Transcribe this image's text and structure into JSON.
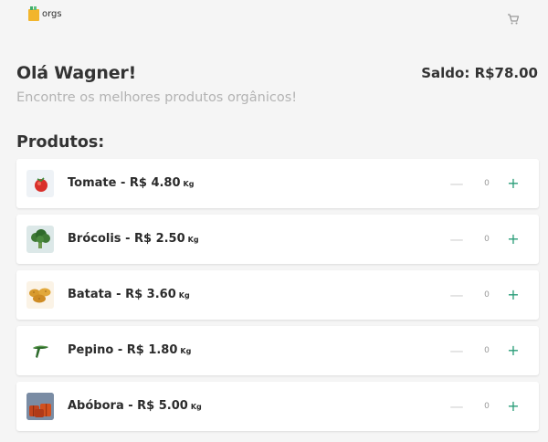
{
  "app": {
    "logo_text": "orgs"
  },
  "header": {
    "greeting": "Olá Wagner!",
    "balance": "Saldo: R$78.00",
    "subtitle": "Encontre os melhores produtos orgânicos!"
  },
  "products_title": "Produtos:",
  "products": [
    {
      "label": "Tomate - R$ 4.80",
      "unit": "Kg",
      "quantity": "0",
      "minus": "—",
      "plus": "+",
      "icon": "tomato-icon"
    },
    {
      "label": "Brócolis - R$ 2.50",
      "unit": "Kg",
      "quantity": "0",
      "minus": "—",
      "plus": "+",
      "icon": "broccoli-icon"
    },
    {
      "label": "Batata - R$ 3.60",
      "unit": "Kg",
      "quantity": "0",
      "minus": "—",
      "plus": "+",
      "icon": "potato-icon"
    },
    {
      "label": "Pepino - R$ 1.80",
      "unit": "Kg",
      "quantity": "0",
      "minus": "—",
      "plus": "+",
      "icon": "cucumber-icon"
    },
    {
      "label": "Abóbora - R$ 5.00",
      "unit": "Kg",
      "quantity": "0",
      "minus": "—",
      "plus": "+",
      "icon": "pumpkin-icon"
    }
  ],
  "colors": {
    "accent": "#2a9d78",
    "background": "#f5f5f5",
    "card": "#ffffff",
    "muted_text": "#b3b3b3"
  }
}
